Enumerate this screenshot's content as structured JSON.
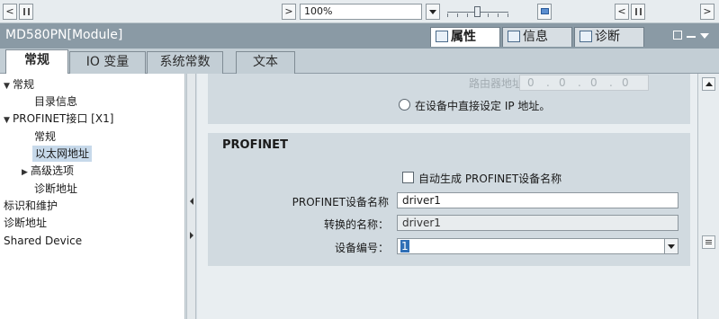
{
  "toolbar": {
    "scroll_left_btn": "<",
    "scroll_mid_btn": ">",
    "zoom_value": "100%",
    "nav_left": "<",
    "nav_right": ">"
  },
  "titlebar": {
    "title": "MD580PN[Module]",
    "tabs": [
      {
        "label": "属性",
        "icon": "properties-icon"
      },
      {
        "label": "信息",
        "icon": "info-icon"
      },
      {
        "label": "诊断",
        "icon": "diagnostics-icon"
      }
    ]
  },
  "tabs": [
    {
      "label": "常规"
    },
    {
      "label": "IO 变量"
    },
    {
      "label": "系统常数"
    },
    {
      "label": "文本"
    }
  ],
  "tree": [
    {
      "label": "常规",
      "expanded": true
    },
    {
      "label": "目录信息"
    },
    {
      "label": "PROFINET接口 [X1]",
      "expanded": true
    },
    {
      "label": "常规"
    },
    {
      "label": "以太网地址",
      "selected": true
    },
    {
      "label": "高级选项",
      "collapsed": true
    },
    {
      "label": "诊断地址"
    },
    {
      "label": "标识和维护"
    },
    {
      "label": "诊断地址"
    },
    {
      "label": "Shared Device"
    }
  ],
  "ip_section": {
    "router_label": "路由器地址：",
    "router_octets": [
      "0",
      "0",
      "0",
      "0"
    ],
    "radio_label": "在设备中直接设定 IP 地址。"
  },
  "profinet": {
    "heading": "PROFINET",
    "auto_name_label": "自动生成 PROFINET设备名称",
    "device_name_label": "PROFINET设备名称",
    "device_name_value": "driver1",
    "converted_label": "转换的名称：",
    "converted_value": "driver1",
    "device_number_label": "设备编号：",
    "device_number_value": "1"
  }
}
